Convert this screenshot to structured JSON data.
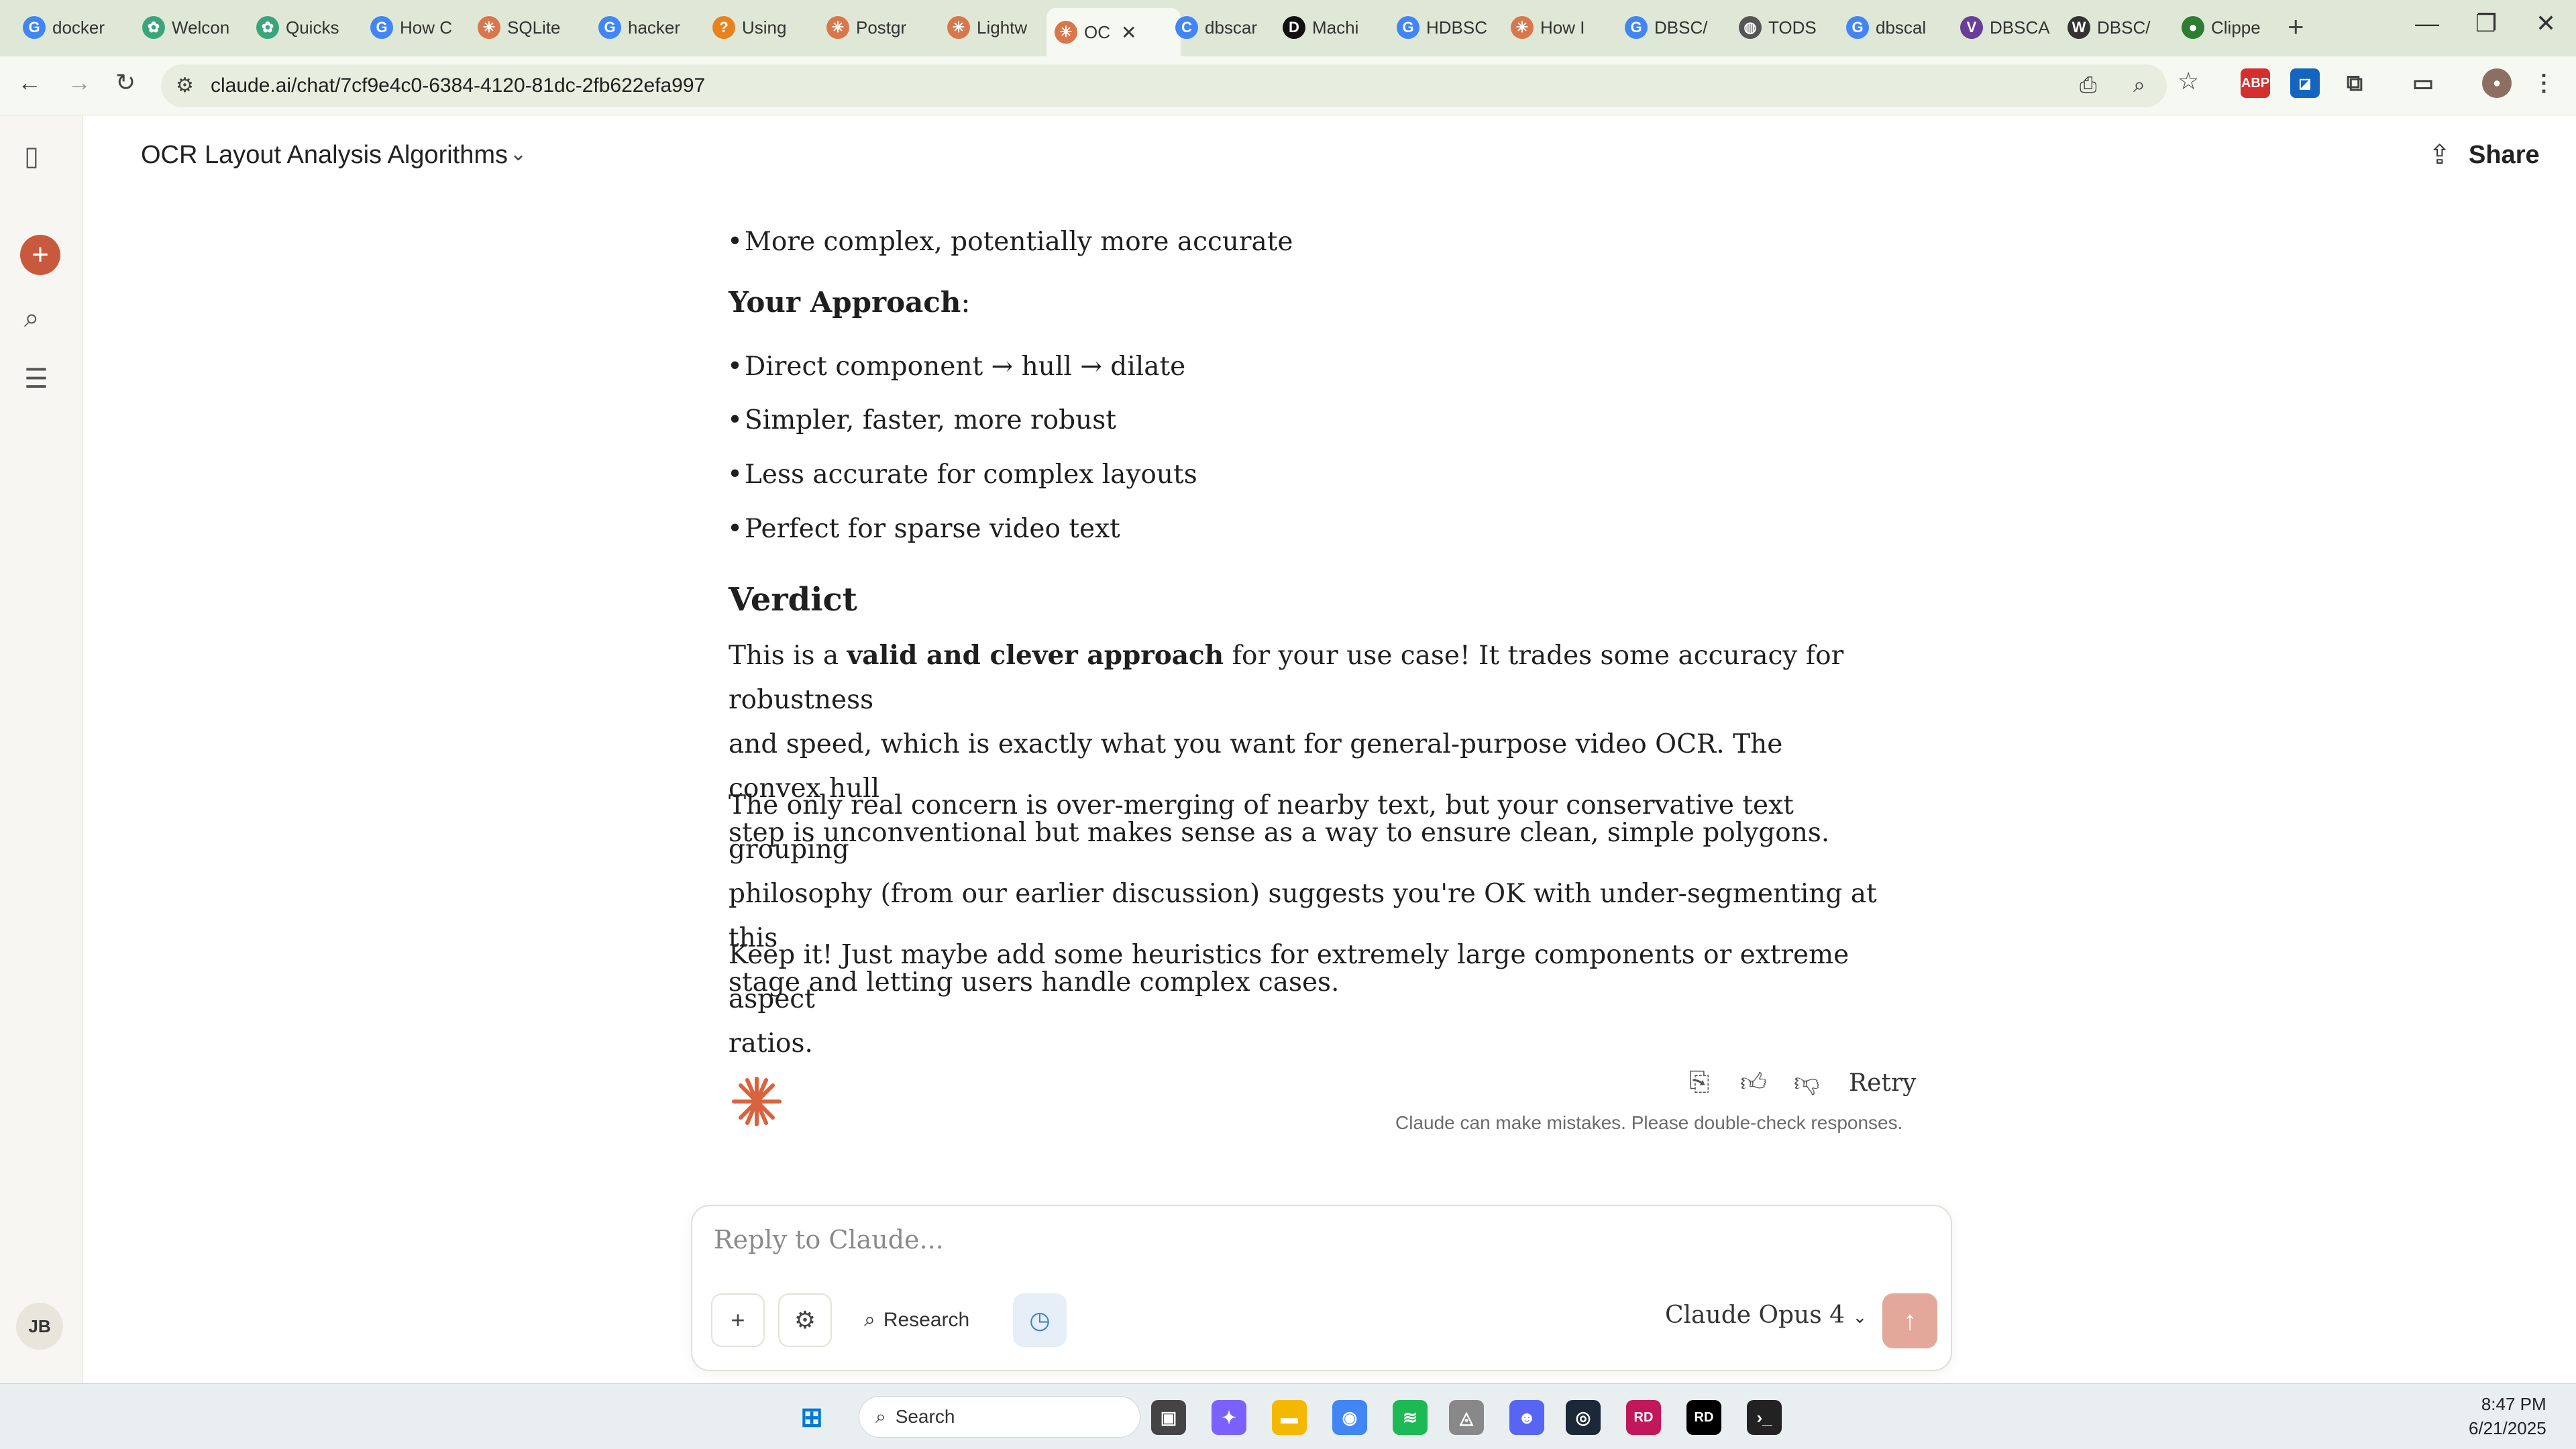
{
  "browser": {
    "tabs": [
      {
        "label": "docker",
        "color": "#4285f4",
        "glyph": "G"
      },
      {
        "label": "Welcon",
        "color": "#3aa57a",
        "glyph": "✿"
      },
      {
        "label": "Quicks",
        "color": "#3aa57a",
        "glyph": "✿"
      },
      {
        "label": "How C",
        "color": "#4285f4",
        "glyph": "G"
      },
      {
        "label": "SQLite",
        "color": "#d9774c",
        "glyph": "✳"
      },
      {
        "label": "hacker",
        "color": "#4285f4",
        "glyph": "G"
      },
      {
        "label": "Using",
        "color": "#e8821e",
        "glyph": "?"
      },
      {
        "label": "Postgr",
        "color": "#d9774c",
        "glyph": "✳"
      },
      {
        "label": "Lightw",
        "color": "#d9774c",
        "glyph": "✳"
      },
      {
        "label": "OC",
        "color": "#d9774c",
        "glyph": "✳"
      },
      {
        "label": "dbscar",
        "color": "#4285f4",
        "glyph": "C"
      },
      {
        "label": "Machi",
        "color": "#111111",
        "glyph": "D"
      },
      {
        "label": "HDBSC",
        "color": "#4285f4",
        "glyph": "G"
      },
      {
        "label": "How I",
        "color": "#d9774c",
        "glyph": "✳"
      },
      {
        "label": "DBSC/",
        "color": "#4285f4",
        "glyph": "G"
      },
      {
        "label": "TODS",
        "color": "#555555",
        "glyph": "◍"
      },
      {
        "label": "dbscal",
        "color": "#4285f4",
        "glyph": "G"
      },
      {
        "label": "DBSCA",
        "color": "#6a3d9a",
        "glyph": "V"
      },
      {
        "label": "DBSC/",
        "color": "#333333",
        "glyph": "W"
      },
      {
        "label": "Clippe",
        "color": "#2e7d32",
        "glyph": "●"
      }
    ],
    "url": "claude.ai/chat/7cf9e4c0-6384-4120-81dc-2fb622efa997",
    "ext_abp": "ABP"
  },
  "header": {
    "chat_title": "OCR Layout Analysis Algorithms",
    "share_label": "Share"
  },
  "content": {
    "top_bullet": "More complex, potentially more accurate",
    "approach_heading": "Your Approach",
    "approach_colon": ":",
    "bullet1_a": "Direct component",
    "bullet1_arrow": "→",
    "bullet1_b": "hull → dilate",
    "bullet2": "Simpler, faster, more robust",
    "bullet3": "Less accurate for complex layouts",
    "bullet4": "Perfect for sparse video text",
    "verdict_heading": "Verdict",
    "para1_pre": "This is a ",
    "para1_bold": "valid and clever approach",
    "para1_post": " for your use case! It trades some accuracy for robustness",
    "para1_line2": "and speed, which is exactly what you want for general-purpose video OCR. The convex hull",
    "para1_line3": "step is unconventional but makes sense as a way to ensure clean, simple polygons.",
    "para2_line1": "The only real concern is over-merging of nearby text, but your conservative text grouping",
    "para2_line2": "philosophy (from our earlier discussion) suggests you're OK with under-segmenting at this",
    "para2_line3": "stage and letting users handle complex cases.",
    "para3_line1": "Keep it! Just maybe add some heuristics for extremely large components or extreme aspect",
    "para3_line2": "ratios."
  },
  "actions": {
    "retry_label": "Retry",
    "disclaimer": "Claude can make mistakes. Please double-check responses."
  },
  "composer": {
    "placeholder": "Reply to Claude...",
    "research_label": "Research",
    "model_label": "Claude Opus 4"
  },
  "sidebar": {
    "avatar_initials": "JB"
  },
  "taskbar": {
    "search_label": "Search",
    "time": "8:47 PM",
    "date": "6/21/2025"
  },
  "colors": {
    "accent": "#c9593d",
    "tabstrip": "#dfe8d6",
    "send_disabled": "#e3a89a"
  }
}
